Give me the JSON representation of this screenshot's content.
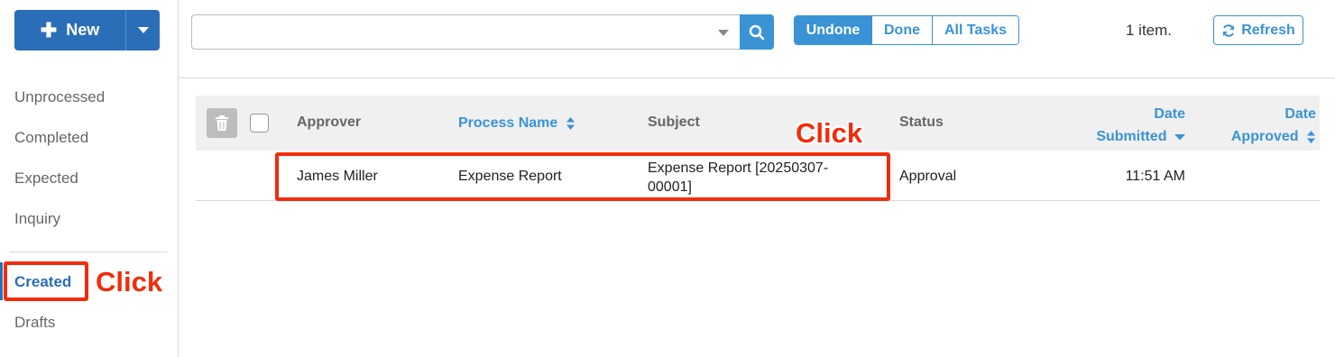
{
  "sidebar": {
    "new_label": "New",
    "items": [
      {
        "label": "Unprocessed"
      },
      {
        "label": "Completed"
      },
      {
        "label": "Expected"
      },
      {
        "label": "Inquiry"
      },
      {
        "label": "Created"
      },
      {
        "label": "Drafts"
      }
    ],
    "active_item": "Created"
  },
  "toolbar": {
    "search": {
      "value": "",
      "placeholder": ""
    },
    "filters": [
      {
        "label": "Undone",
        "active": true
      },
      {
        "label": "Done",
        "active": false
      },
      {
        "label": "All Tasks",
        "active": false
      }
    ],
    "count_text": "1 item.",
    "refresh_label": "Refresh"
  },
  "table": {
    "headers": {
      "approver": "Approver",
      "process_name": "Process Name",
      "subject": "Subject",
      "status": "Status",
      "date_submitted_line1": "Date",
      "date_submitted_line2": "Submitted",
      "date_approved_line1": "Date",
      "date_approved_line2": "Approved"
    },
    "rows": [
      {
        "approver": "James Miller",
        "process_name": "Expense Report",
        "subject_line1": "Expense Report [20250307-",
        "subject_line2": "00001]",
        "status": "Approval",
        "date_submitted": "11:51 AM",
        "date_approved": ""
      }
    ]
  },
  "annotations": {
    "click_label_1": "Click",
    "click_label_2": "Click",
    "color": "#f12c0c"
  },
  "colors": {
    "primary": "#2a6eb8",
    "accent": "#3a93d4"
  }
}
